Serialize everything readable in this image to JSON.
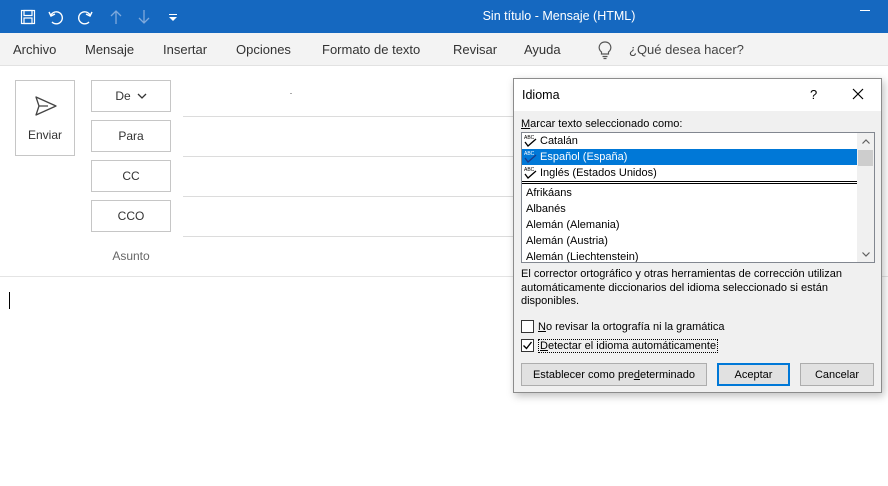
{
  "titlebar": {
    "title": "Sin título  -  Mensaje (HTML)",
    "qat_icons": [
      "save-icon",
      "undo-icon",
      "redo-icon",
      "arrow-up-icon",
      "arrow-down-icon",
      "customize-icon"
    ],
    "color": "#1568c0"
  },
  "menu": {
    "items": [
      "Archivo",
      "Mensaje",
      "Insertar",
      "Opciones",
      "Formato de texto",
      "Revisar",
      "Ayuda"
    ],
    "tell_me": "¿Qué desea hacer?"
  },
  "compose": {
    "send_label": "Enviar",
    "from_label": "De",
    "to_label": "Para",
    "cc_label": "CC",
    "bcc_label": "CCO",
    "subject_label": "Asunto"
  },
  "dialog": {
    "title": "Idioma",
    "help": "?",
    "mark_label_prefix": "M",
    "mark_label_rest": "arcar texto seleccionado como:",
    "languages": [
      {
        "label": "Catalán",
        "proofing": true,
        "selected": false
      },
      {
        "label": "Español (España)",
        "proofing": true,
        "selected": true
      },
      {
        "label": "Inglés (Estados Unidos)",
        "proofing": true,
        "selected": false
      },
      {
        "label": "Afrikáans",
        "proofing": false,
        "selected": false
      },
      {
        "label": "Albanés",
        "proofing": false,
        "selected": false
      },
      {
        "label": "Alemán (Alemania)",
        "proofing": false,
        "selected": false
      },
      {
        "label": "Alemán (Austria)",
        "proofing": false,
        "selected": false
      },
      {
        "label": "Alemán (Liechtenstein)",
        "proofing": false,
        "selected": false
      }
    ],
    "description": "El corrector ortográfico y otras herramientas de corrección utilizan automáticamente diccionarios del idioma seleccionado si están disponibles.",
    "no_proof_prefix": "N",
    "no_proof_rest": "o revisar la ortografía ni la gramática",
    "no_proof_checked": false,
    "detect_prefix": "D",
    "detect_rest": "etectar el idioma automáticamente",
    "detect_checked": true,
    "set_default_a": "Establecer como pre",
    "set_default_u": "d",
    "set_default_b": "eterminado",
    "ok": "Aceptar",
    "cancel": "Cancelar",
    "accent": "#0078d7"
  }
}
